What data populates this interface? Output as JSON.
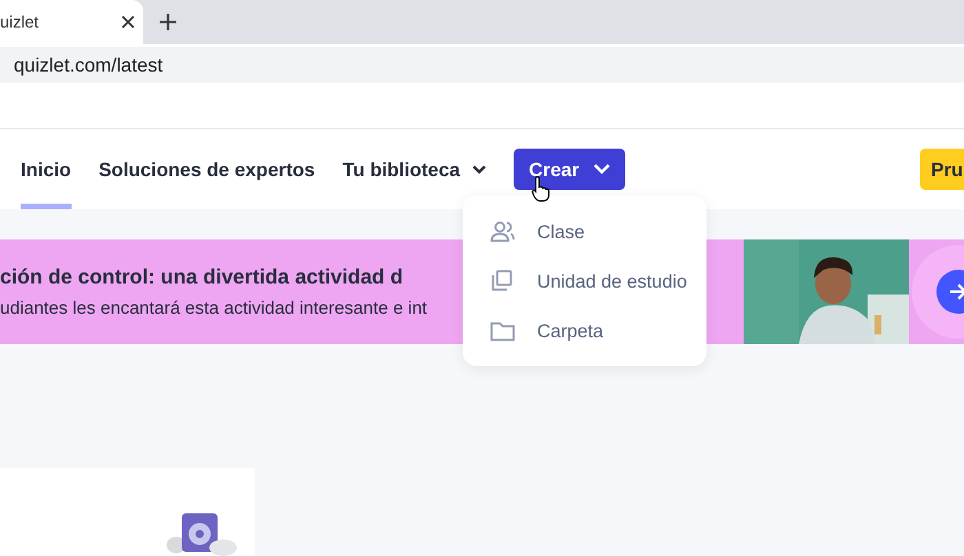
{
  "browser": {
    "tabs": [
      {
        "title": "uizlet",
        "selected": true
      }
    ],
    "address": "quizlet.com/latest"
  },
  "nav": {
    "items": [
      {
        "label": "Inicio",
        "selected": true,
        "kind": "link"
      },
      {
        "label": "Soluciones de expertos",
        "selected": false,
        "kind": "link"
      },
      {
        "label": "Tu biblioteca",
        "selected": false,
        "kind": "dropdown"
      }
    ],
    "create_button": "Crear",
    "trial_button": "Pru"
  },
  "create_menu": {
    "items": [
      {
        "label": "Clase",
        "kind": "people"
      },
      {
        "label": "Unidad de estudio",
        "kind": "cards"
      },
      {
        "label": "Carpeta",
        "kind": "folder"
      }
    ]
  },
  "banner": {
    "title": "ción de control: una divertida actividad d",
    "subtitle": "udiantes les encantará esta actividad interesante e int"
  }
}
